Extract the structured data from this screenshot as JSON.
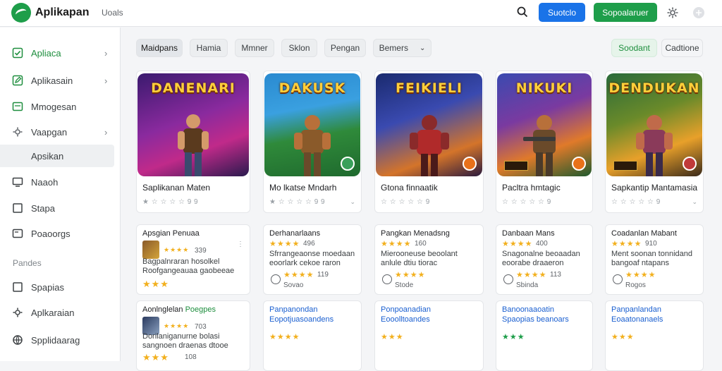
{
  "header": {
    "app_title": "Aplikapan",
    "nav_link": "Uoals",
    "primary_button": "Suotclo",
    "green_button": "Sopoalaruer"
  },
  "sidebar": {
    "items": [
      {
        "label": "Apliaca",
        "icon": "check-square-icon",
        "chevron": "›"
      },
      {
        "label": "Aplikasain",
        "icon": "edit-icon",
        "chevron": "›"
      },
      {
        "label": "Mmogesan",
        "icon": "window-icon"
      },
      {
        "label": "Vaapgan",
        "icon": "gear-icon",
        "chevron": "›"
      },
      {
        "label": "Apsikan",
        "icon": ""
      },
      {
        "label": "Naaoh",
        "icon": "monitor-icon"
      },
      {
        "label": "Stapa",
        "icon": "square-icon"
      },
      {
        "label": "Poaoorgs",
        "icon": "panel-icon"
      }
    ],
    "section_label": "Pandes",
    "section_items": [
      {
        "label": "Spapias",
        "icon": "square-icon"
      },
      {
        "label": "Aplkaraian",
        "icon": "gear-icon"
      },
      {
        "label": "Spplidaarag",
        "icon": "globe-icon"
      }
    ]
  },
  "chips": [
    {
      "label": "Maidpans"
    },
    {
      "label": "Hamia"
    },
    {
      "label": "Mmner"
    },
    {
      "label": "Sklon"
    },
    {
      "label": "Pengan"
    },
    {
      "label": "Bemers",
      "dropdown": "⌄"
    },
    {
      "label": "Soodant"
    },
    {
      "label": "Cadtione"
    }
  ],
  "games": [
    {
      "name": "Saplikanan Maten",
      "meta": "★ ☆ ☆ ☆ ☆ 9 9",
      "thumb_title": "DANENARI",
      "colors": [
        "#3a1a6e",
        "#c02a8a"
      ],
      "accent": "#f5b942"
    },
    {
      "name": "Mo lkatse Mndarh",
      "meta": "★ ☆ ☆ ☆ ☆ 9 9",
      "thumb_title": "DAKUSK",
      "colors": [
        "#1f6a2e",
        "#5cbf3a"
      ],
      "accent": "#a56b2a"
    },
    {
      "name": "Gtona finnaatik",
      "meta": "☆ ☆ ☆ ☆ ☆ 9",
      "thumb_title": "FEIKIELI",
      "colors": [
        "#2a3b8e",
        "#d4742a"
      ],
      "accent": "#b02a2a"
    },
    {
      "name": "Pacltra hmtagic",
      "meta": "☆ ☆ ☆ ☆ ☆ 9",
      "thumb_title": "NIKUKI",
      "colors": [
        "#1a5a8e",
        "#e07a2a"
      ],
      "accent": "#6a4a2a"
    },
    {
      "name": "Sapkantip Mantamasia",
      "meta": "☆ ☆ ☆ ☆ ☆ 9",
      "thumb_title": "DENDUKAN",
      "colors": [
        "#2a5a2e",
        "#e8a02a"
      ],
      "accent": "#c03a3a"
    }
  ],
  "cards_row1": [
    {
      "title": "Apsgian Penuaa",
      "stars": "★★★★",
      "count": "339",
      "text": "Bagpalnraran hosolkel Roofgangeauaa gaobeeae",
      "extra_stars": "★★★"
    },
    {
      "title": "Derhanarlaans",
      "stars": "★★★★",
      "count": "496",
      "text": "Sfrrangeaonse moedaan eoorlark cekoe raron",
      "extra_stars": "★★★★",
      "extra_count": "119",
      "foot": "Sovao"
    },
    {
      "title": "Pangkan Menadsng",
      "stars": "★★★★",
      "count": "160",
      "text": "Mierooneuse beoolant anlule dtiu tiorac",
      "extra_stars": "★★★★",
      "foot": "Stode"
    },
    {
      "title": "Danbaan Mans",
      "stars": "★★★★",
      "count": "400",
      "text": "Snagonalne beoaadan eoorabe draaeron",
      "extra_stars": "★★★★",
      "extra_count": "113",
      "foot": "Sbinda"
    },
    {
      "title": "Coadanlan Mabant",
      "stars": "★★★★",
      "count": "910",
      "text": "Ment soonan tonnidand bangoaf ntapans",
      "extra_stars": "★★★★",
      "foot": "Rogos"
    }
  ],
  "cards_row2": [
    {
      "title": "Aonlnglelan",
      "title_green": "Poegpes",
      "stars": "★★★★",
      "count": "703",
      "text": "Dorilaniganurne bolasi sangnoen draenas dtooe",
      "extra_stars": "★★★",
      "extra_count": "108"
    },
    {
      "title": "Panpanondan",
      "subtitle": "Eopotjuasoandens",
      "stars": "★★★★"
    },
    {
      "title": "Ponpoanadian",
      "subtitle": "Eooolltoandes",
      "stars": "★★★"
    },
    {
      "title": "Banoonaaoatin",
      "subtitle": "Spaopias beanoars",
      "stars": "★★★"
    },
    {
      "title": "Panpanlandan",
      "subtitle": "Eoaatonanaels",
      "stars": "★★★"
    }
  ]
}
